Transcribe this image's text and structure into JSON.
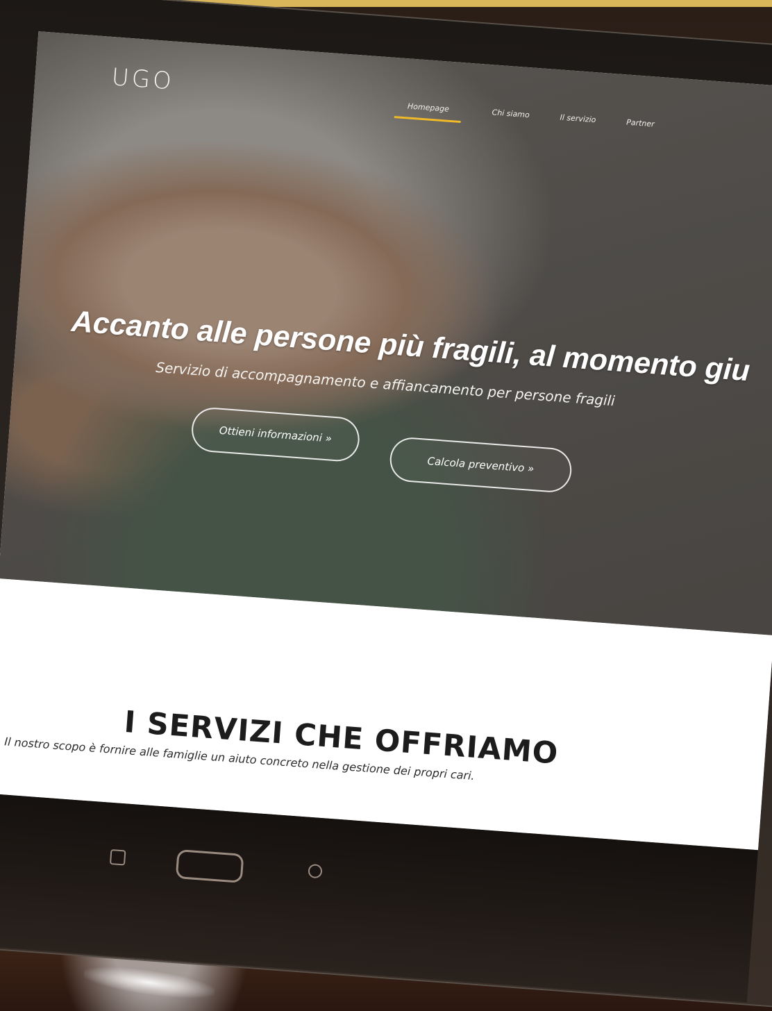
{
  "brand": {
    "logo_text": "UGO"
  },
  "nav": {
    "items": [
      {
        "label": "Homepage",
        "active": true
      },
      {
        "label": "Chi siamo",
        "active": false
      },
      {
        "label": "Il servizio",
        "active": false
      },
      {
        "label": "Partner",
        "active": false
      }
    ]
  },
  "hero": {
    "title": "Accanto alle persone più fragili, al momento giu",
    "subtitle": "Servizio di accompagnamento e affiancamento per persone fragili",
    "buttons": {
      "info_label": "Ottieni informazioni »",
      "quote_label": "Calcola preventivo »"
    }
  },
  "services": {
    "title": "I SERVIZI CHE OFFRIAMO",
    "description": "Il nostro scopo è fornire alle famiglie un aiuto concreto nella gestione dei propri cari."
  },
  "colors": {
    "accent": "#f0b92a",
    "hero_text": "#ffffff",
    "section_text": "#1c1c1c",
    "top_strip": "#d9b65a"
  },
  "icons": {
    "device_back": "back-icon",
    "device_home": "home-icon",
    "device_menu": "menu-icon"
  }
}
